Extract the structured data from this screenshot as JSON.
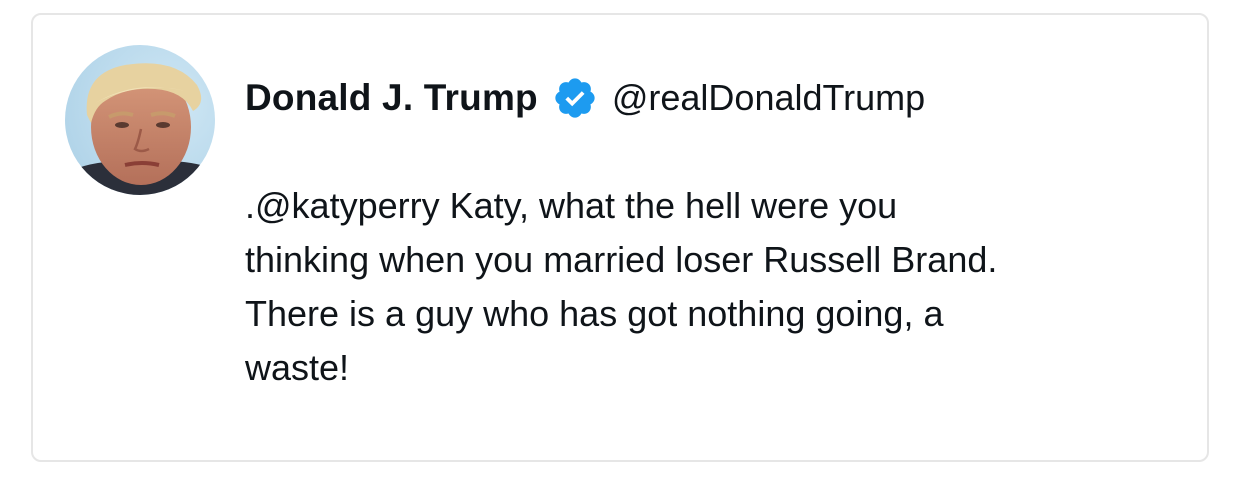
{
  "tweet": {
    "author": {
      "display_name": "Donald J. Trump",
      "handle": "@realDonaldTrump",
      "verified": true,
      "avatar_icon": "profile-photo",
      "verified_icon": "verified-badge-icon"
    },
    "text": ".@katyperry Katy, what the hell were you\nthinking when you married loser Russell Brand.\nThere is a guy who has got nothing going, a\nwaste!"
  },
  "colors": {
    "text": "#0f1419",
    "verified_blue": "#1d9bf0",
    "border": "#e6e6e6",
    "background": "#ffffff"
  }
}
